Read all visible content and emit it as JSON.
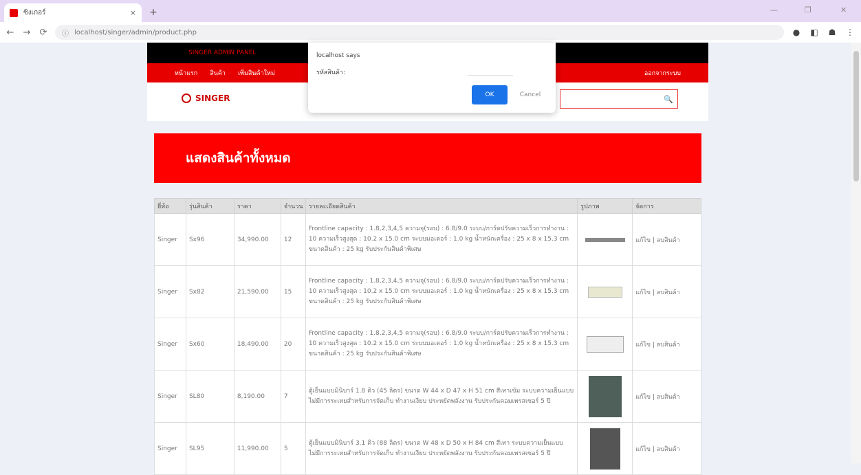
{
  "browser": {
    "tab_title": "ซิงเกอร์",
    "tab_close": "×",
    "new_tab": "+",
    "url": "localhost/singer/admin/product.php",
    "window_controls": [
      "—",
      "❐",
      "✕"
    ]
  },
  "site": {
    "top_bar_text": "SINGER ADMIN PANEL",
    "nav_items": [
      "หน้าแรก",
      "สินค้า",
      "เพิ่มสินค้าใหม่"
    ],
    "nav_right": "ออกจากระบบ",
    "logo_text": "SINGER",
    "search_icon": "🔍",
    "banner_title": "แสดงสินค้าทั้งหมด"
  },
  "table": {
    "headers": [
      "ยี่ห้อ",
      "รุ่นสินค้า",
      "ราคา",
      "จำนวน",
      "รายละเอียดสินค้า",
      "รูปภาพ",
      "จัดการ"
    ],
    "rows": [
      {
        "brand": "Singer",
        "model": "Sx96",
        "price": "34,990.00",
        "qty": "12",
        "desc": "Frontline capacity : 1.8,2,3,4,5 ความจุ(รอบ) : 6.8/9.0 ระบบ/การ์ดปรับความเร็วการทำงาน : 10 ความเร็วสูงสุด : 10.2 x 15.0 cm ระบบมอเตอร์ : 1.0 kg น้ำหนักเครื่อง : 25 x 8 x 15.3 cm ขนาดสินค้า : 25 kg รับประกันสินค้าพิเศษ",
        "actions": "แก้ไข | ลบสินค้า"
      },
      {
        "brand": "Singer",
        "model": "Sx82",
        "price": "21,590.00",
        "qty": "15",
        "desc": "Frontline capacity : 1.8,2,3,4,5 ความจุ(รอบ) : 6.8/9.0 ระบบ/การ์ดปรับความเร็วการทำงาน : 10 ความเร็วสูงสุด : 10.2 x 15.0 cm ระบบมอเตอร์ : 1.0 kg น้ำหนักเครื่อง : 25 x 8 x 15.3 cm ขนาดสินค้า : 25 kg รับประกันสินค้าพิเศษ",
        "actions": "แก้ไข | ลบสินค้า"
      },
      {
        "brand": "Singer",
        "model": "Sx60",
        "price": "18,490.00",
        "qty": "20",
        "desc": "Frontline capacity : 1.8,2,3,4,5 ความจุ(รอบ) : 6.8/9.0 ระบบ/การ์ดปรับความเร็วการทำงาน : 10 ความเร็วสูงสุด : 10.2 x 15.0 cm ระบบมอเตอร์ : 1.0 kg น้ำหนักเครื่อง : 25 x 8 x 15.3 cm ขนาดสินค้า : 25 kg รับประกันสินค้าพิเศษ",
        "actions": "แก้ไข | ลบสินค้า"
      },
      {
        "brand": "Singer",
        "model": "SL80",
        "price": "8,190.00",
        "qty": "7",
        "desc": "ตู้เย็นแบบมินิบาร์ 1.8 คิว (45 ลิตร) ขนาด W 44 x D 47 x H 51 cm สีเทาเข้ม ระบบความเย็นแบบไม่มีการระเหยสำหรับการจัดเก็บ ทำงานเงียบ ประหยัดพลังงาน รับประกันคอมเพรสเซอร์ 5 ปี",
        "actions": "แก้ไข | ลบสินค้า"
      },
      {
        "brand": "Singer",
        "model": "SL95",
        "price": "11,990.00",
        "qty": "5",
        "desc": "ตู้เย็นแบบมินิบาร์ 3.1 คิว (88 ลิตร) ขนาด W 48 x D 50 x H 84 cm สีเทา ระบบความเย็นแบบไม่มีการระเหยสำหรับการจัดเก็บ ทำงานเงียบ ประหยัดพลังงาน รับประกันคอมเพรสเซอร์ 5 ปี",
        "actions": "แก้ไข | ลบสินค้า"
      }
    ]
  },
  "dialog": {
    "title": "localhost says",
    "message": "รหัสสินค้า:",
    "ok_label": "OK",
    "cancel_label": "Cancel"
  }
}
